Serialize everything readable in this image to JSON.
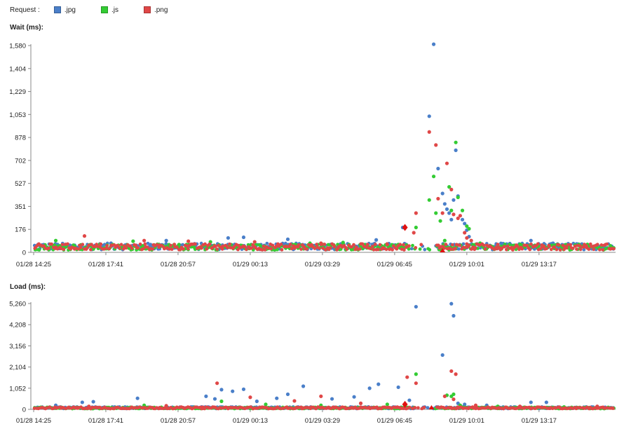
{
  "legend": {
    "label": "Request :",
    "items": [
      {
        "name": ".jpg",
        "color": "#4a7fc9"
      },
      {
        "name": ".js",
        "color": "#33cc33"
      },
      {
        "name": ".png",
        "color": "#e04747"
      }
    ]
  },
  "chart_data": [
    {
      "type": "scatter",
      "title": "Wait (ms):",
      "xlabel": "",
      "ylabel": "",
      "x_ticks": [
        "01/28 14:25",
        "01/28 17:41",
        "01/28 20:57",
        "01/29 00:13",
        "01/29 03:29",
        "01/29 06:45",
        "01/29 10:01",
        "01/29 13:17"
      ],
      "y_ticks": [
        "0",
        "176",
        "351",
        "527",
        "702",
        "878",
        "1,053",
        "1,229",
        "1,404",
        "1,580"
      ],
      "ylim": [
        0,
        1580
      ],
      "xlim_hours": [
        0,
        26.33
      ],
      "grid": false,
      "legend_position": "top-left",
      "series": [
        {
          "name": ".jpg",
          "color": "#4a7fc9",
          "baseline": 45,
          "points": [
            [
              0.2,
              60
            ],
            [
              3.5,
              70
            ],
            [
              6.0,
              90
            ],
            [
              8.8,
              110
            ],
            [
              9.5,
              115
            ],
            [
              11.5,
              100
            ],
            [
              15.5,
              95
            ],
            [
              16.7,
              190
            ],
            [
              18.1,
              1590
            ],
            [
              17.9,
              1040
            ],
            [
              18.3,
              640
            ],
            [
              18.5,
              450
            ],
            [
              18.6,
              370
            ],
            [
              18.7,
              330
            ],
            [
              18.8,
              300
            ],
            [
              18.9,
              250
            ],
            [
              19.0,
              400
            ],
            [
              19.1,
              780
            ],
            [
              19.2,
              430
            ],
            [
              19.4,
              250
            ],
            [
              19.5,
              220
            ],
            [
              19.6,
              170
            ],
            [
              19.7,
              120
            ],
            [
              22.5,
              90
            ],
            [
              23.5,
              70
            ],
            [
              25.5,
              55
            ]
          ]
        },
        {
          "name": ".js",
          "color": "#33cc33",
          "baseline": 40,
          "points": [
            [
              1.0,
              90
            ],
            [
              4.5,
              85
            ],
            [
              8.0,
              80
            ],
            [
              12.5,
              70
            ],
            [
              14.0,
              75
            ],
            [
              16.5,
              60
            ],
            [
              17.3,
              190
            ],
            [
              17.9,
              400
            ],
            [
              18.1,
              580
            ],
            [
              18.2,
              300
            ],
            [
              18.4,
              240
            ],
            [
              18.6,
              90
            ],
            [
              18.8,
              500
            ],
            [
              18.9,
              320
            ],
            [
              19.1,
              840
            ],
            [
              19.2,
              420
            ],
            [
              19.4,
              320
            ],
            [
              19.6,
              200
            ],
            [
              19.7,
              180
            ],
            [
              20.2,
              70
            ],
            [
              22.0,
              60
            ],
            [
              24.5,
              55
            ]
          ]
        },
        {
          "name": ".png",
          "color": "#e04747",
          "baseline": 42,
          "points": [
            [
              2.3,
              125
            ],
            [
              5.0,
              90
            ],
            [
              7.0,
              85
            ],
            [
              10.0,
              80
            ],
            [
              13.0,
              70
            ],
            [
              16.0,
              60
            ],
            [
              16.8,
              190
            ],
            [
              17.3,
              300
            ],
            [
              17.2,
              150
            ],
            [
              17.9,
              920
            ],
            [
              18.2,
              820
            ],
            [
              18.3,
              410
            ],
            [
              18.5,
              300
            ],
            [
              18.7,
              680
            ],
            [
              18.9,
              480
            ],
            [
              19.0,
              290
            ],
            [
              19.2,
              260
            ],
            [
              19.3,
              280
            ],
            [
              19.5,
              150
            ],
            [
              19.6,
              110
            ],
            [
              19.8,
              90
            ],
            [
              21.0,
              60
            ],
            [
              23.0,
              55
            ],
            [
              25.0,
              50
            ]
          ]
        }
      ],
      "highlight_markers": [
        {
          "series": ".png",
          "x": 16.8,
          "y": 190,
          "shape": "diamond"
        },
        {
          "series": ".png",
          "x": 18.5,
          "y": 0,
          "shape": "triangle"
        }
      ]
    },
    {
      "type": "scatter",
      "title": "Load (ms):",
      "xlabel": "",
      "ylabel": "",
      "x_ticks": [
        "01/28 14:25",
        "01/28 17:41",
        "01/28 20:57",
        "01/29 00:13",
        "01/29 03:29",
        "01/29 06:45",
        "01/29 10:01",
        "01/29 13:17"
      ],
      "y_ticks": [
        "0",
        "1,052",
        "2,104",
        "3,156",
        "4,208",
        "5,260"
      ],
      "ylim": [
        0,
        5260
      ],
      "xlim_hours": [
        0,
        26.33
      ],
      "grid": false,
      "legend_position": "top-left",
      "series": [
        {
          "name": ".jpg",
          "color": "#4a7fc9",
          "baseline": 80,
          "points": [
            [
              1.0,
              200
            ],
            [
              2.2,
              350
            ],
            [
              2.7,
              380
            ],
            [
              4.7,
              550
            ],
            [
              7.8,
              650
            ],
            [
              8.2,
              520
            ],
            [
              8.5,
              980
            ],
            [
              9.0,
              900
            ],
            [
              9.5,
              1000
            ],
            [
              10.1,
              400
            ],
            [
              11.0,
              550
            ],
            [
              11.5,
              750
            ],
            [
              12.2,
              1150
            ],
            [
              13.5,
              520
            ],
            [
              14.5,
              620
            ],
            [
              15.2,
              1050
            ],
            [
              15.6,
              1250
            ],
            [
              16.5,
              1100
            ],
            [
              17.3,
              5100
            ],
            [
              17.0,
              450
            ],
            [
              18.5,
              2700
            ],
            [
              18.9,
              5250
            ],
            [
              19.0,
              4650
            ],
            [
              19.2,
              300
            ],
            [
              19.5,
              250
            ],
            [
              20.5,
              200
            ],
            [
              22.5,
              350
            ],
            [
              23.2,
              350
            ],
            [
              25.0,
              120
            ]
          ]
        },
        {
          "name": ".js",
          "color": "#33cc33",
          "baseline": 70,
          "points": [
            [
              5.0,
              200
            ],
            [
              8.5,
              400
            ],
            [
              10.5,
              250
            ],
            [
              13.0,
              200
            ],
            [
              16.0,
              250
            ],
            [
              17.3,
              1750
            ],
            [
              18.7,
              700
            ],
            [
              18.9,
              650
            ],
            [
              19.0,
              750
            ],
            [
              19.3,
              200
            ],
            [
              21.0,
              150
            ],
            [
              24.0,
              120
            ]
          ]
        },
        {
          "name": ".png",
          "color": "#e04747",
          "baseline": 75,
          "points": [
            [
              2.5,
              150
            ],
            [
              6.0,
              180
            ],
            [
              8.3,
              1300
            ],
            [
              9.8,
              600
            ],
            [
              11.8,
              420
            ],
            [
              13.0,
              650
            ],
            [
              14.8,
              300
            ],
            [
              16.9,
              1600
            ],
            [
              17.3,
              1300
            ],
            [
              18.9,
              1900
            ],
            [
              19.1,
              1750
            ],
            [
              18.6,
              650
            ],
            [
              19.0,
              500
            ],
            [
              20.0,
              200
            ],
            [
              22.0,
              150
            ],
            [
              25.5,
              150
            ]
          ]
        }
      ],
      "highlight_markers": [
        {
          "series": ".png",
          "x": 16.8,
          "y": 250,
          "shape": "diamond"
        },
        {
          "series": ".png",
          "x": 18.0,
          "y": 0,
          "shape": "triangle"
        }
      ]
    }
  ]
}
